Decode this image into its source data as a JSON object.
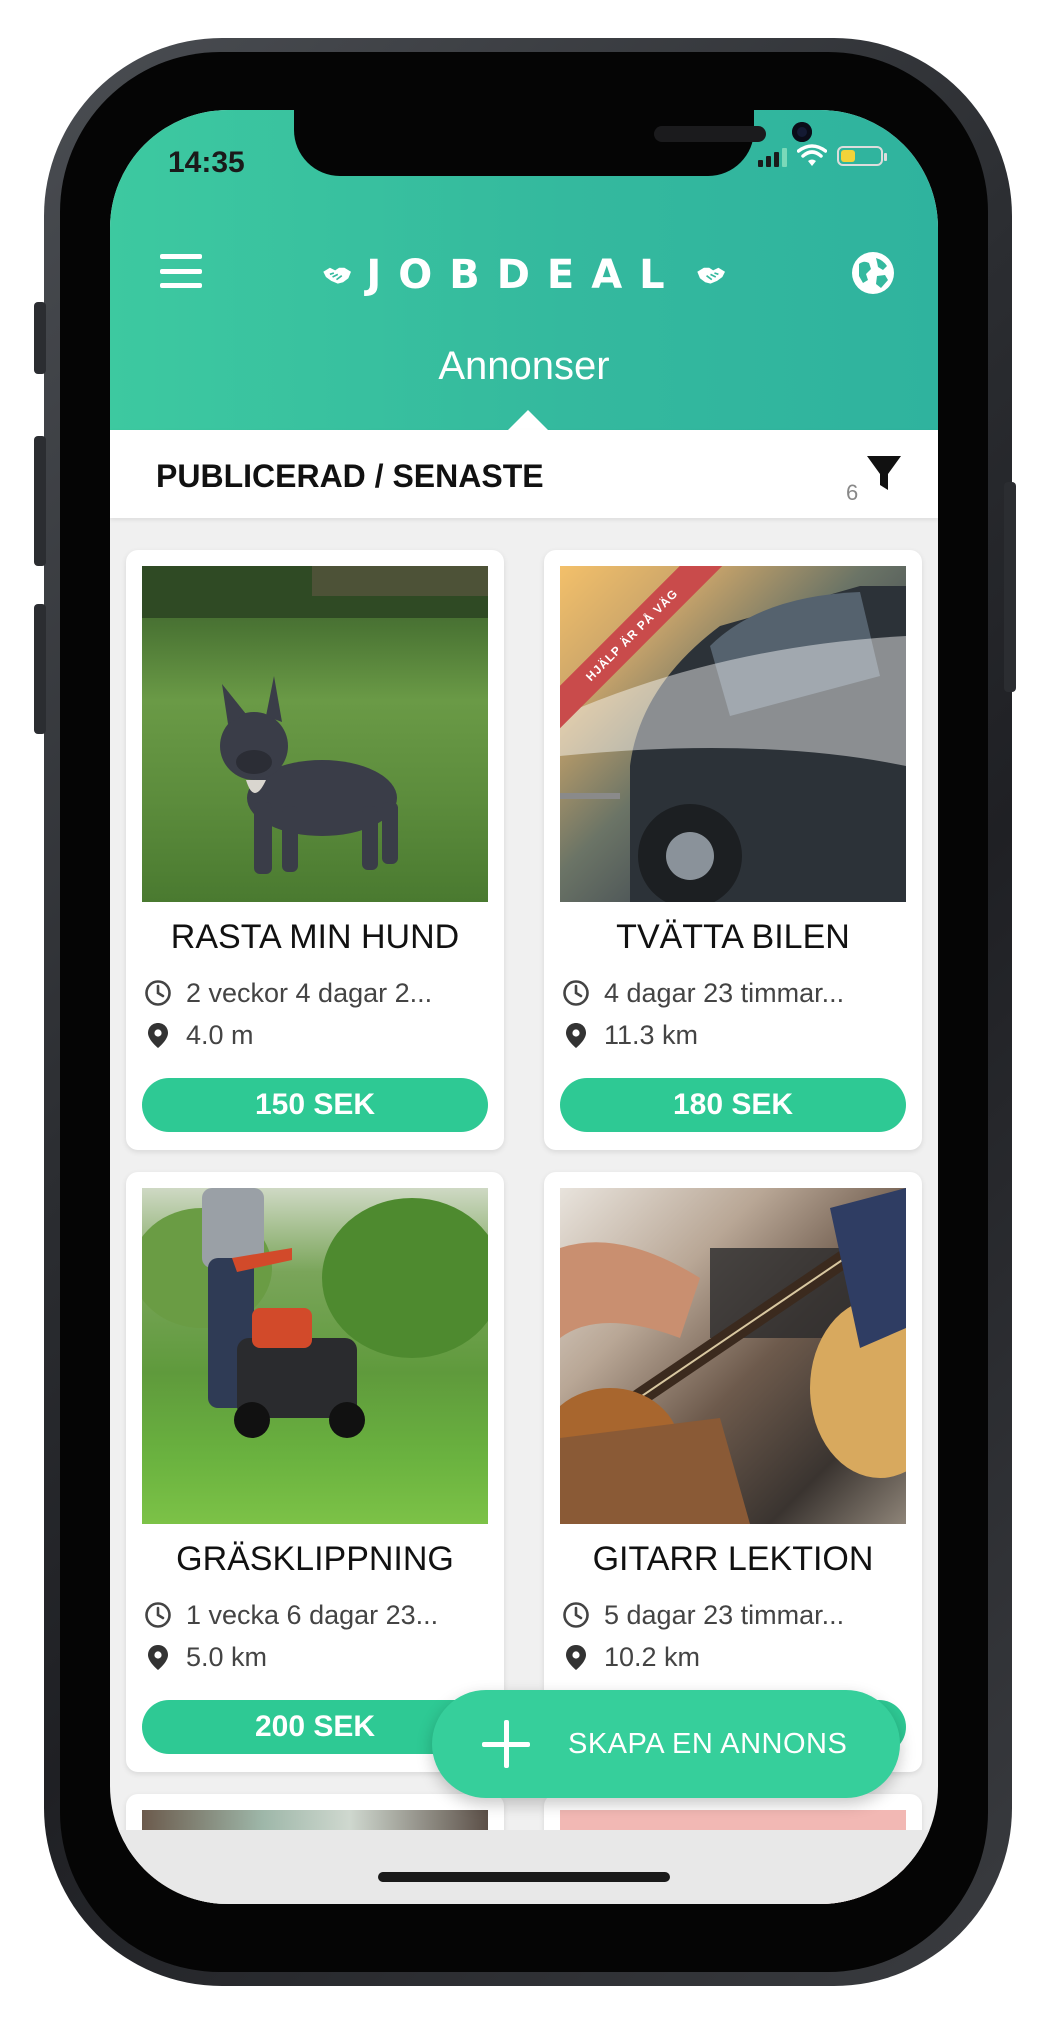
{
  "status_bar": {
    "time": "14:35"
  },
  "header": {
    "logo": "JOBDEAL",
    "title": "Annonser"
  },
  "filter": {
    "label": "PUBLICERAD / SENASTE",
    "count": "6"
  },
  "cards": [
    {
      "title": "RASTA MIN HUND",
      "time": "2 veckor 4 dagar 2...",
      "distance": "4.0 m",
      "price": "150 SEK"
    },
    {
      "title": "TVÄTTA BILEN",
      "time": "4 dagar 23 timmar...",
      "distance": "11.3 km",
      "price": "180 SEK",
      "ribbon": "HJÄLP ÄR PÅ VÄG"
    },
    {
      "title": "GRÄSKLIPPNING",
      "time": "1 vecka 6 dagar 23...",
      "distance": "5.0 km",
      "price": "200 SEK"
    },
    {
      "title": "GITARR LEKTION",
      "time": "5 dagar 23 timmar...",
      "distance": "10.2 km",
      "price": ""
    }
  ],
  "fab": {
    "label": "SKAPA EN ANNONS"
  },
  "colors": {
    "header_start": "#3dc9a0",
    "header_end": "#2fb39e",
    "accent": "#2ec994",
    "fab": "#36cf9b"
  },
  "icons": [
    "menu-icon",
    "handshake-icon",
    "globe-icon",
    "filter-icon",
    "clock-icon",
    "location-pin-icon",
    "plus-icon"
  ]
}
